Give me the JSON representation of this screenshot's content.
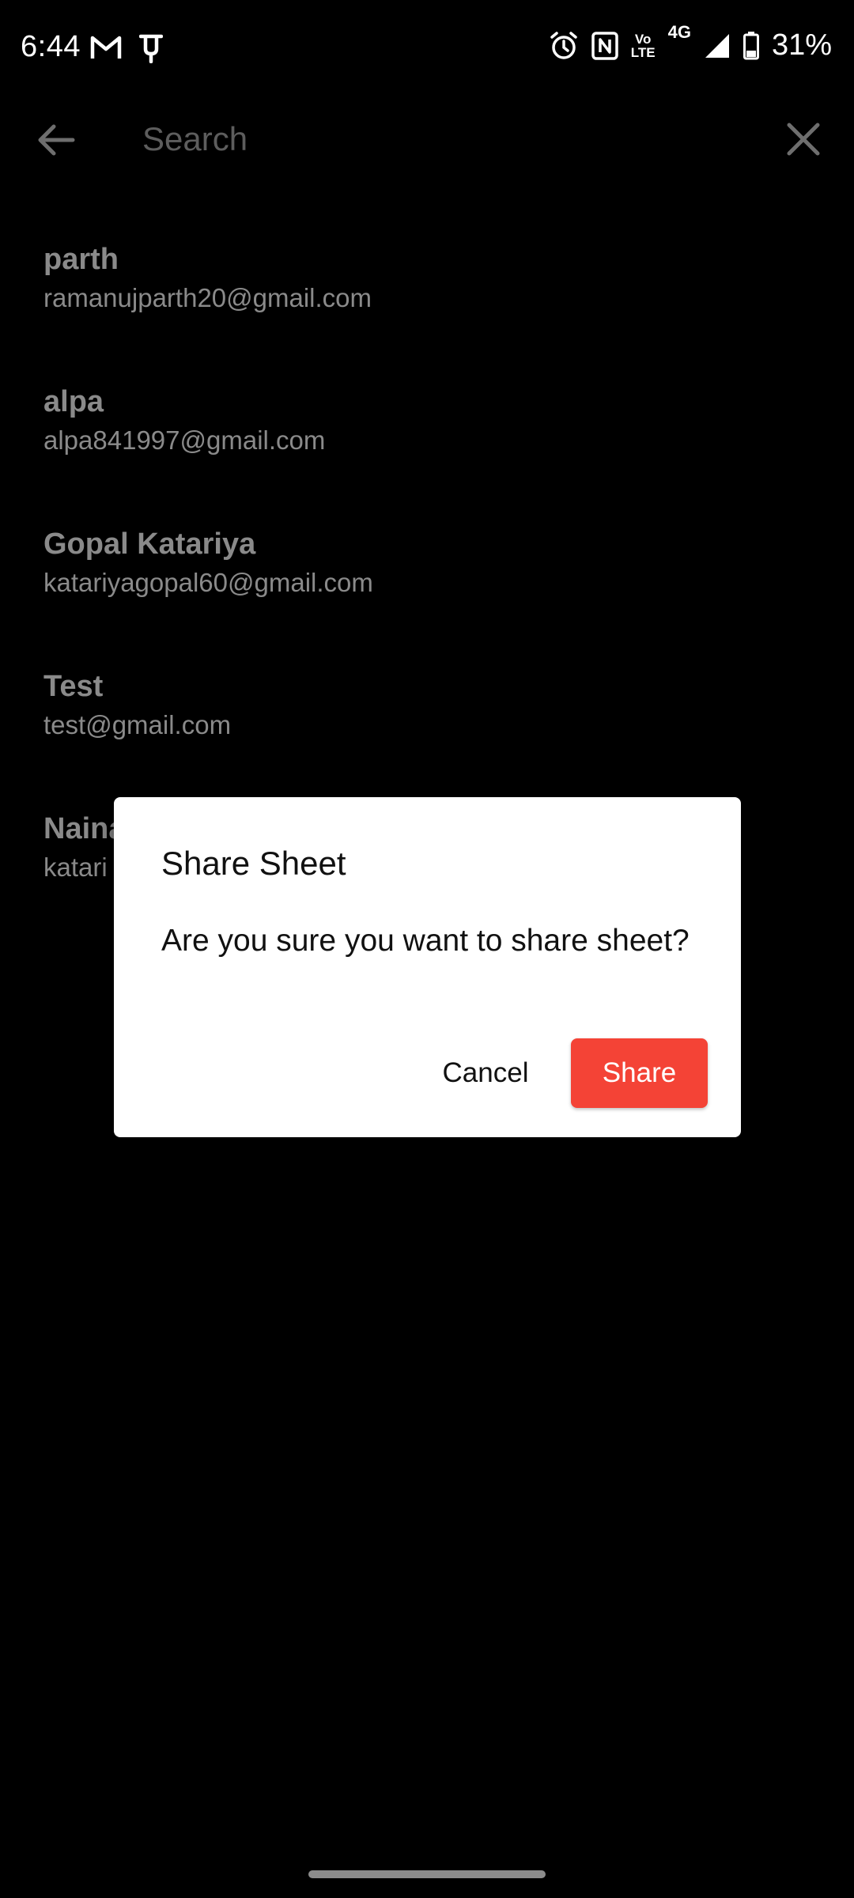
{
  "status_bar": {
    "time": "6:44",
    "battery_percent": "31%",
    "volte_top": "Vo",
    "volte_bottom": "LTE",
    "network": "4G",
    "left_icons": [
      "gmail-icon",
      "phonepe-icon"
    ],
    "right_icons": [
      "alarm-icon",
      "nfc-icon",
      "volte-icon",
      "4g-icon",
      "signal-icon",
      "battery-icon"
    ]
  },
  "search": {
    "placeholder": "Search",
    "value": ""
  },
  "contacts": [
    {
      "name": "parth",
      "email": "ramanujparth20@gmail.com"
    },
    {
      "name": "alpa",
      "email": "alpa841997@gmail.com"
    },
    {
      "name": "Gopal Katariya",
      "email": "katariyagopal60@gmail.com"
    },
    {
      "name": "Test",
      "email": "test@gmail.com"
    },
    {
      "name": "Naina",
      "email": "katari"
    }
  ],
  "dialog": {
    "title": "Share Sheet",
    "message": "Are you sure you want to share sheet?",
    "cancel_label": "Cancel",
    "share_label": "Share"
  },
  "colors": {
    "background": "#000000",
    "dialog_bg": "#ffffff",
    "accent": "#f44336",
    "dimmed_text": "#8a8a8a"
  }
}
